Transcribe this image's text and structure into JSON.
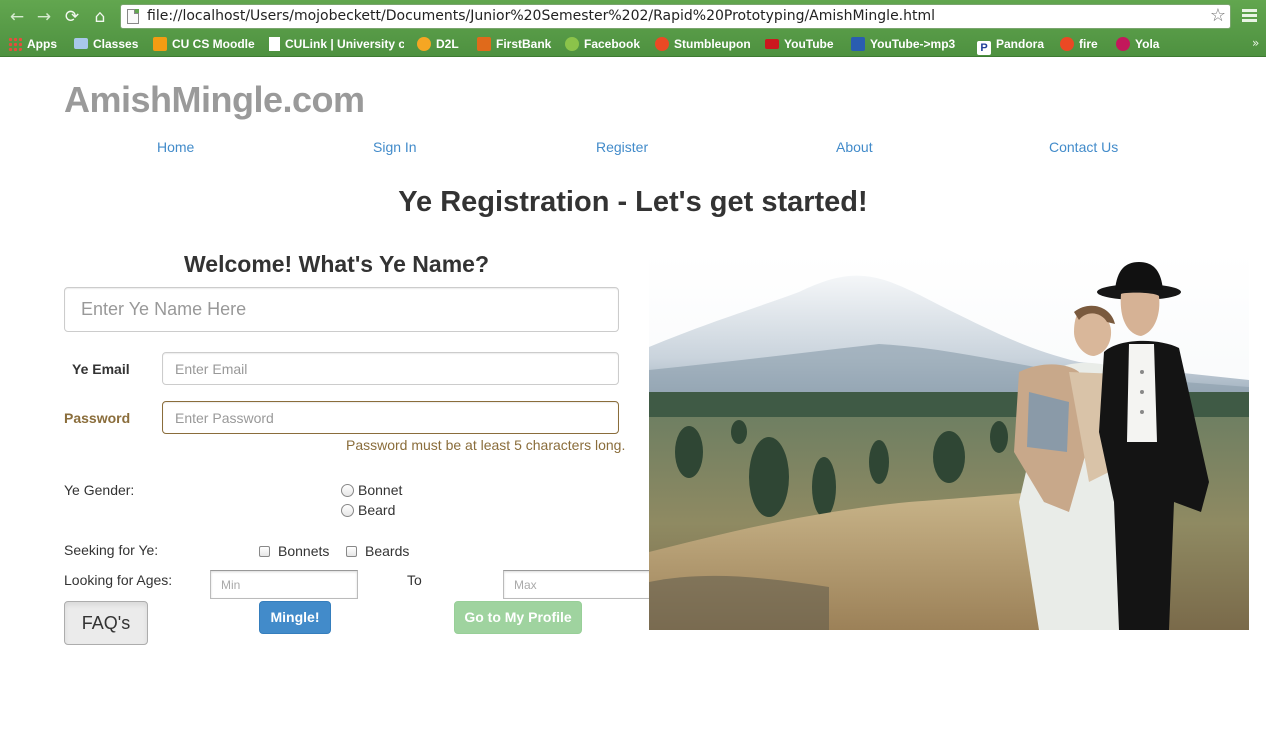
{
  "browser": {
    "url": "file://localhost/Users/mojobeckett/Documents/Junior%20Semester%202/Rapid%20Prototyping/AmishMingle.html",
    "bookmarks": [
      {
        "label": "Apps",
        "icon": "apps-grid-icon",
        "color": "#e8a33d"
      },
      {
        "label": "Classes",
        "icon": "folder-icon",
        "color": "#9cc2e8"
      },
      {
        "label": "CU CS Moodle",
        "icon": "moodle-icon",
        "color": "#f39c12"
      },
      {
        "label": "CULink | University c",
        "icon": "page-icon",
        "color": "#ffffff"
      },
      {
        "label": "D2L",
        "icon": "d2l-icon",
        "color": "#f5a623"
      },
      {
        "label": "FirstBank",
        "icon": "firstbank-icon",
        "color": "#e06a1b"
      },
      {
        "label": "Facebook",
        "icon": "facebook-icon",
        "color": "#8bc34a"
      },
      {
        "label": "Stumbleupon",
        "icon": "stumbleupon-icon",
        "color": "#eb4924"
      },
      {
        "label": "YouTube",
        "icon": "youtube-icon",
        "color": "#cc181e"
      },
      {
        "label": "YouTube->mp3",
        "icon": "youtube-mp3-icon",
        "color": "#2a5db0"
      },
      {
        "label": "Pandora",
        "icon": "pandora-icon",
        "color": "#ffffff"
      },
      {
        "label": "fire",
        "icon": "stumbleupon-icon",
        "color": "#eb4924"
      },
      {
        "label": "Yola",
        "icon": "yola-icon",
        "color": "#c2185b"
      }
    ]
  },
  "site": {
    "logo": "AmishMingle.com",
    "nav": [
      "Home",
      "Sign In",
      "Register",
      "About",
      "Contact Us"
    ]
  },
  "page": {
    "headline": "Ye Registration - Let's get started!",
    "welcome": "Welcome! What's Ye Name?",
    "name_placeholder": "Enter Ye Name Here",
    "email_label": "Ye Email",
    "email_placeholder": "Enter Email",
    "password_label": "Password",
    "password_placeholder": "Enter Password",
    "password_help": "Password must be at least 5 characters long.",
    "gender_label": "Ye Gender:",
    "gender_options": [
      "Bonnet",
      "Beard"
    ],
    "seeking_label": "Seeking for Ye:",
    "seeking_options": [
      "Bonnets",
      "Beards"
    ],
    "ages_label": "Looking for Ages:",
    "ages_to": "To",
    "age_min_placeholder": "Min",
    "age_max_placeholder": "Max",
    "faq_button": "FAQ's",
    "mingle_button": "Mingle!",
    "profile_button": "Go to My Profile"
  },
  "colors": {
    "link": "#428bca",
    "warning": "#8a6d3b",
    "primary": "#428bca",
    "success_disabled": "#9fd39f",
    "logo": "#9a9a9a",
    "chrome": "#5a9e4a"
  }
}
